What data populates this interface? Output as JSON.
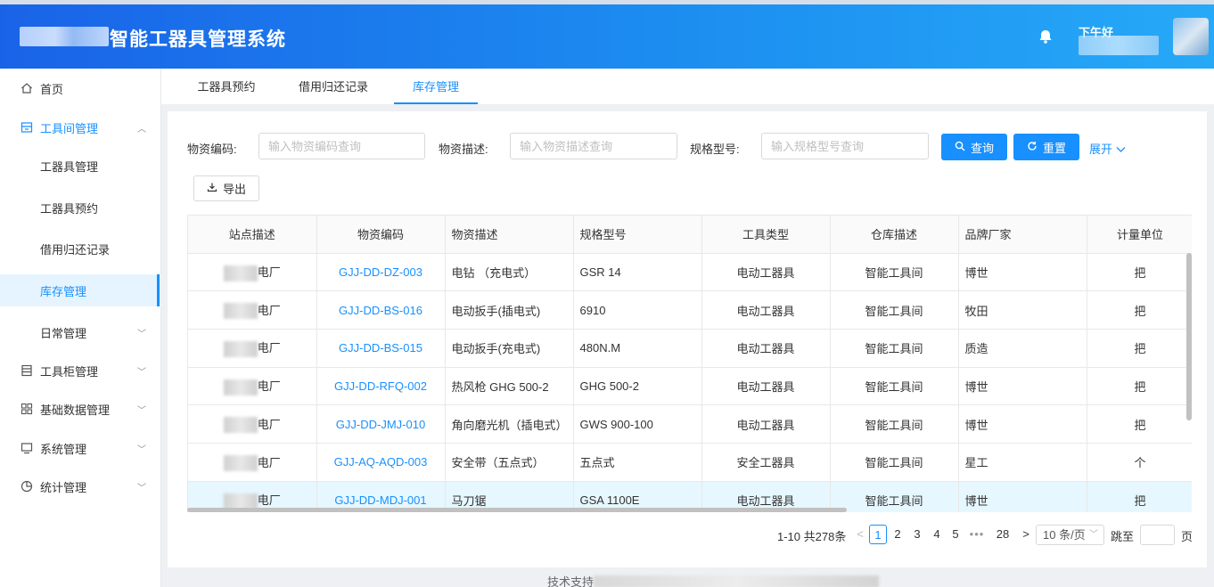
{
  "header": {
    "app_title": "智能工器具管理系统",
    "greeting": "下午好",
    "notifications_icon": "bell-icon"
  },
  "sidebar": {
    "items": [
      {
        "label": "首页",
        "icon": "home-icon"
      },
      {
        "label": "工具间管理",
        "icon": "store-icon",
        "state": "open"
      },
      {
        "label": "工器具管理"
      },
      {
        "label": "工器具预约"
      },
      {
        "label": "借用归还记录"
      },
      {
        "label": "库存管理",
        "state": "active"
      },
      {
        "label": "日常管理"
      },
      {
        "label": "工具柜管理",
        "icon": "cabinet-icon"
      },
      {
        "label": "基础数据管理",
        "icon": "grid-icon"
      },
      {
        "label": "系统管理",
        "icon": "monitor-icon"
      },
      {
        "label": "统计管理",
        "icon": "pie-chart-icon"
      }
    ]
  },
  "tabs": [
    {
      "label": "工器具预约"
    },
    {
      "label": "借用归还记录"
    },
    {
      "label": "库存管理",
      "active": true
    }
  ],
  "filters": {
    "code_label": "物资编码:",
    "code_placeholder": "输入物资编码查询",
    "desc_label": "物资描述:",
    "desc_placeholder": "输入物资描述查询",
    "spec_label": "规格型号:",
    "spec_placeholder": "输入规格型号查询",
    "search_label": "查询",
    "reset_label": "重置",
    "expand_label": "展开",
    "export_label": "导出"
  },
  "table": {
    "columns": [
      "站点描述",
      "物资编码",
      "物资描述",
      "规格型号",
      "工具类型",
      "仓库描述",
      "品牌厂家",
      "计量单位"
    ],
    "rows": [
      {
        "site": "电厂",
        "code": "GJJ-DD-DZ-003",
        "desc": "电钻 （充电式）",
        "spec": "GSR 14",
        "type": "电动工器具",
        "warehouse": "智能工具间",
        "brand": "博世",
        "unit": "把"
      },
      {
        "site": "电厂",
        "code": "GJJ-DD-BS-016",
        "desc": "电动扳手(插电式)",
        "spec": "6910",
        "type": "电动工器具",
        "warehouse": "智能工具间",
        "brand": "牧田",
        "unit": "把"
      },
      {
        "site": "电厂",
        "code": "GJJ-DD-BS-015",
        "desc": "电动扳手(充电式)",
        "spec": "480N.M",
        "type": "电动工器具",
        "warehouse": "智能工具间",
        "brand": "质造",
        "unit": "把"
      },
      {
        "site": "电厂",
        "code": "GJJ-DD-RFQ-002",
        "desc": "热风枪 GHG 500-2",
        "spec": "GHG 500-2",
        "type": "电动工器具",
        "warehouse": "智能工具间",
        "brand": "博世",
        "unit": "把"
      },
      {
        "site": "电厂",
        "code": "GJJ-DD-JMJ-010",
        "desc": "角向磨光机（插电式）",
        "spec": "GWS 900-100",
        "type": "电动工器具",
        "warehouse": "智能工具间",
        "brand": "博世",
        "unit": "把"
      },
      {
        "site": "电厂",
        "code": "GJJ-AQ-AQD-003",
        "desc": "安全带（五点式）",
        "spec": "五点式",
        "type": "安全工器具",
        "warehouse": "智能工具间",
        "brand": "星工",
        "unit": "个"
      },
      {
        "site": "电厂",
        "code": "GJJ-DD-MDJ-001",
        "desc": "马刀锯",
        "spec": "GSA 1100E",
        "type": "电动工器具",
        "warehouse": "智能工具间",
        "brand": "博世",
        "unit": "把"
      }
    ]
  },
  "pagination": {
    "summary": "1-10 共278条",
    "prev": "<",
    "pages": [
      "1",
      "2",
      "3",
      "4",
      "5"
    ],
    "ellipsis": "•••",
    "last_page": "28",
    "next": ">",
    "page_size": "10 条/页",
    "jump_label": "跳至",
    "page_suffix": "页",
    "current_page": 1
  },
  "footer": {
    "text": "技术支持"
  },
  "colors": {
    "accent": "#1890ff",
    "header_start": "#1a63e8",
    "header_end": "#26a9f7"
  }
}
